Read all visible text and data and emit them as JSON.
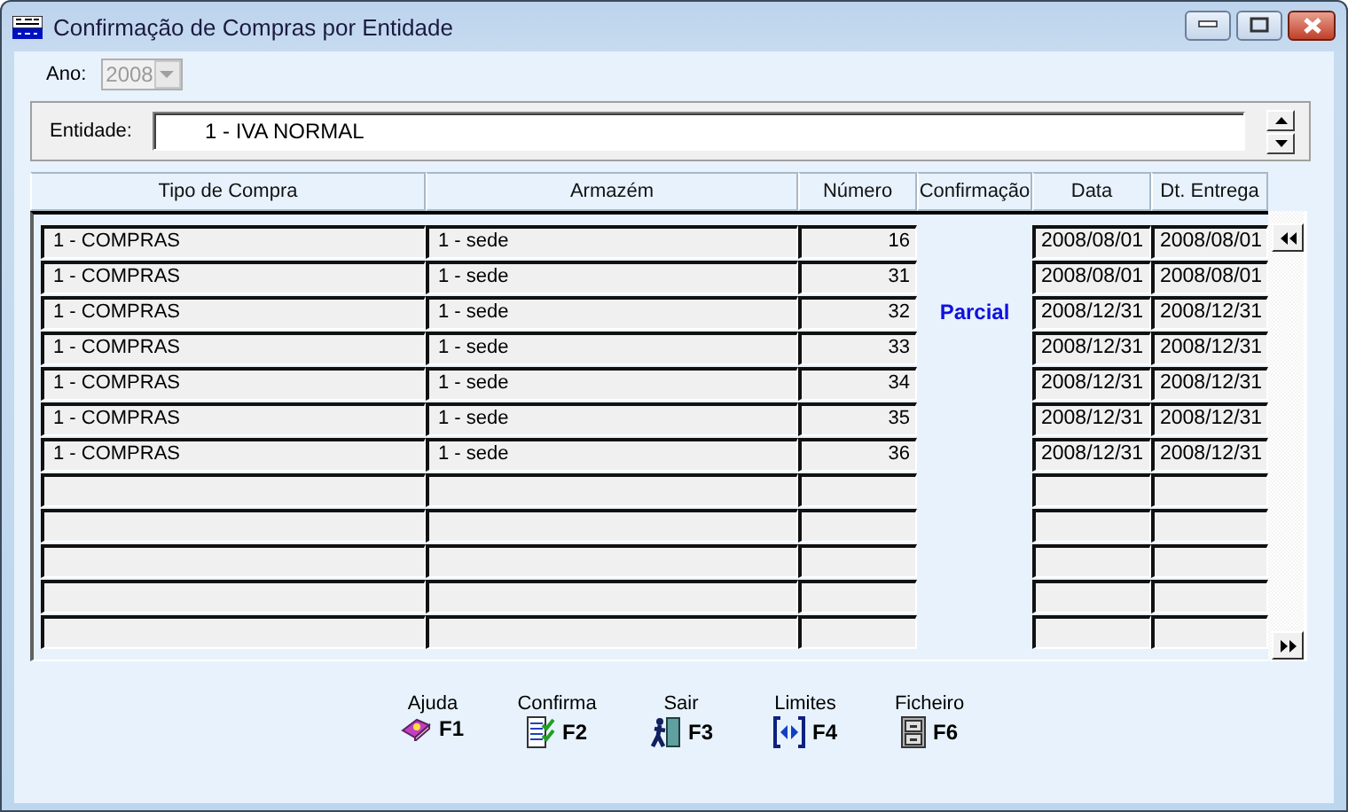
{
  "window": {
    "title": "Confirmação de Compras por Entidade"
  },
  "year": {
    "label": "Ano:",
    "value": "2008",
    "disabled": true
  },
  "entity": {
    "label": "Entidade:",
    "value": "1 - IVA NORMAL"
  },
  "table": {
    "columns": [
      "Tipo de Compra",
      "Armazém",
      "Número",
      "Confirmação",
      "Data",
      "Dt. Entrega"
    ],
    "confirmation": "Parcial",
    "rows": [
      {
        "tipo": "1 - COMPRAS",
        "armazem": "1 - sede",
        "numero": "16",
        "data": "2008/08/01",
        "entrega": "2008/08/01"
      },
      {
        "tipo": "1 - COMPRAS",
        "armazem": "1 - sede",
        "numero": "31",
        "data": "2008/08/01",
        "entrega": "2008/08/01"
      },
      {
        "tipo": "1 - COMPRAS",
        "armazem": "1 - sede",
        "numero": "32",
        "data": "2008/12/31",
        "entrega": "2008/12/31"
      },
      {
        "tipo": "1 - COMPRAS",
        "armazem": "1 - sede",
        "numero": "33",
        "data": "2008/12/31",
        "entrega": "2008/12/31"
      },
      {
        "tipo": "1 - COMPRAS",
        "armazem": "1 - sede",
        "numero": "34",
        "data": "2008/12/31",
        "entrega": "2008/12/31"
      },
      {
        "tipo": "1 - COMPRAS",
        "armazem": "1 - sede",
        "numero": "35",
        "data": "2008/12/31",
        "entrega": "2008/12/31"
      },
      {
        "tipo": "1 - COMPRAS",
        "armazem": "1 - sede",
        "numero": "36",
        "data": "2008/12/31",
        "entrega": "2008/12/31"
      }
    ]
  },
  "function_keys": [
    {
      "kind": "help",
      "label": "Ajuda",
      "key": "F1"
    },
    {
      "kind": "confirm",
      "label": "Confirma",
      "key": "F2"
    },
    {
      "kind": "exit",
      "label": "Sair",
      "key": "F3"
    },
    {
      "kind": "limits",
      "label": "Limites",
      "key": "F4"
    },
    {
      "kind": "file",
      "label": "Ficheiro",
      "key": "F6"
    }
  ]
}
